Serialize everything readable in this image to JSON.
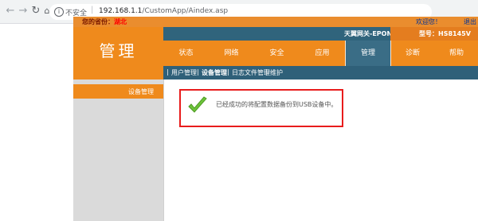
{
  "browser": {
    "back_icon": "arrow-left-icon",
    "forward_icon": "arrow-right-icon",
    "reload_icon": "reload-icon",
    "home_icon": "home-icon",
    "security_label": "不安全",
    "url_host": "192.168.1.1",
    "url_path": "/CustomApp/Aindex.asp"
  },
  "header": {
    "region_label": "您的省份：",
    "region_value": "湖北",
    "welcome": "欢迎您！",
    "logout": "退出",
    "brand_title": "管理",
    "device_name": "天翼网关-EPON",
    "model_label": "型号：HS8145V"
  },
  "tabs": [
    {
      "label": "状态"
    },
    {
      "label": "网络"
    },
    {
      "label": "安全"
    },
    {
      "label": "应用"
    },
    {
      "label": "管理"
    },
    {
      "label": "诊断"
    },
    {
      "label": "帮助"
    }
  ],
  "sub_nav": [
    {
      "label": "用户管理"
    },
    {
      "label": "设备管理"
    },
    {
      "label": "日志文件管理"
    },
    {
      "label": "维护"
    }
  ],
  "sidebar": {
    "item_label": "设备管理"
  },
  "notice": {
    "icon": "checkmark-icon",
    "message": "已经成功的将配置数据备份到USB设备中。"
  },
  "colors": {
    "orange": "#ef8a1c",
    "teal": "#30647c",
    "alert_border": "#e81c1c",
    "check_green": "#6cc33a"
  }
}
